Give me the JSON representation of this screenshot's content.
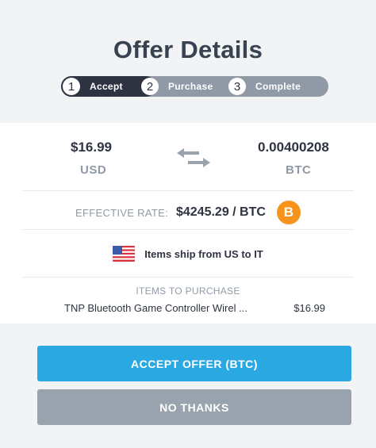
{
  "header": {
    "title": "Offer Details",
    "steps": [
      {
        "num": "1",
        "label": "Accept"
      },
      {
        "num": "2",
        "label": "Purchase"
      },
      {
        "num": "3",
        "label": "Complete"
      }
    ]
  },
  "conversion": {
    "from_amount": "$16.99",
    "from_currency": "USD",
    "to_amount": "0.00400208",
    "to_currency": "BTC"
  },
  "rate": {
    "label": "EFFECTIVE RATE:",
    "value": "$4245.29 / BTC",
    "icon_glyph": "B"
  },
  "shipping": {
    "text": "Items ship from US to IT"
  },
  "items": {
    "label": "ITEMS TO PURCHASE",
    "list": [
      {
        "name": "TNP Bluetooth Game Controller Wirel ...",
        "price": "$16.99"
      }
    ]
  },
  "actions": {
    "accept_label": "ACCEPT OFFER (BTC)",
    "decline_label": "NO THANKS"
  },
  "colors": {
    "accent": "#2aa8e2",
    "muted_button": "#99a3ad",
    "bitcoin": "#f7931a",
    "dark": "#2d3340"
  }
}
